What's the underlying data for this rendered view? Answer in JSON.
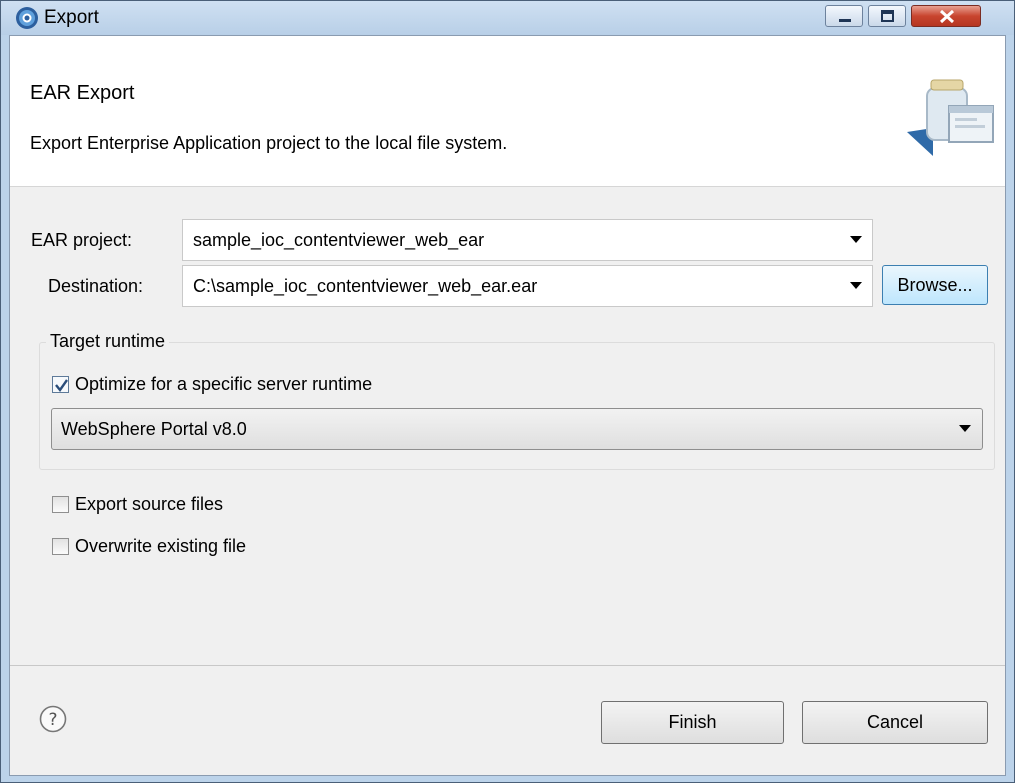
{
  "window": {
    "title": "Export"
  },
  "banner": {
    "title": "EAR Export",
    "description": "Export Enterprise Application project to the local file system."
  },
  "form": {
    "ear_project_label": "EAR project:",
    "ear_project_value": "sample_ioc_contentviewer_web_ear",
    "destination_label": "Destination:",
    "destination_value": "C:\\sample_ioc_contentviewer_web_ear.ear",
    "browse_label": "Browse..."
  },
  "target_runtime": {
    "group_label": "Target runtime",
    "optimize_label": "Optimize for a specific server runtime",
    "optimize_checked": true,
    "runtime_value": "WebSphere Portal v8.0"
  },
  "options": {
    "export_source_label": "Export source files",
    "export_source_checked": false,
    "overwrite_label": "Overwrite existing file",
    "overwrite_checked": false
  },
  "footer": {
    "finish_label": "Finish",
    "cancel_label": "Cancel",
    "help_icon": "help-icon"
  }
}
